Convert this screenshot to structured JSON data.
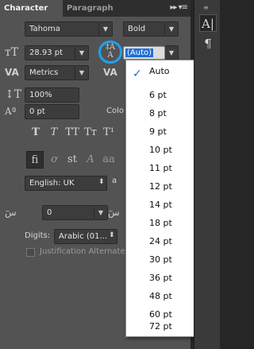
{
  "tabs": {
    "character": "Character",
    "paragraph": "Paragraph",
    "menu_glyph": "▸▸ ▾≡"
  },
  "font": {
    "family": "Tahoma",
    "style": "Bold"
  },
  "size": {
    "value": "28.93 pt"
  },
  "leading": {
    "value": "(Auto)"
  },
  "kerning": {
    "value": "Metrics"
  },
  "vertical_scale": {
    "value": "100%"
  },
  "baseline_shift": {
    "value": "0 pt"
  },
  "color": {
    "label": "Colo"
  },
  "language": {
    "value": "English: UK"
  },
  "arabic_kashida": {
    "value": "0"
  },
  "digits": {
    "label": "Digits:",
    "value": "Arabic (01..."
  },
  "justification_alternates": {
    "label": "Justification Alternates"
  },
  "leading_menu": {
    "selected": "Auto",
    "items": [
      "Auto",
      "6 pt",
      "8 pt",
      "9 pt",
      "10 pt",
      "11 pt",
      "12 pt",
      "14 pt",
      "18 pt",
      "24 pt",
      "30 pt",
      "36 pt",
      "48 pt",
      "60 pt",
      "72 pt"
    ]
  },
  "colors": {
    "accent": "#1ea1f0",
    "panel": "#535353",
    "dark": "#262626"
  },
  "icons": {
    "font-size": "tT-icon",
    "leading": "leading-icon",
    "kerning": "va-icon",
    "tracking": "va-tracking-icon",
    "vertical-scale": "scale-icon",
    "baseline": "baseline-icon",
    "dock-character": "character-icon",
    "dock-paragraph": "pilcrow-icon"
  }
}
